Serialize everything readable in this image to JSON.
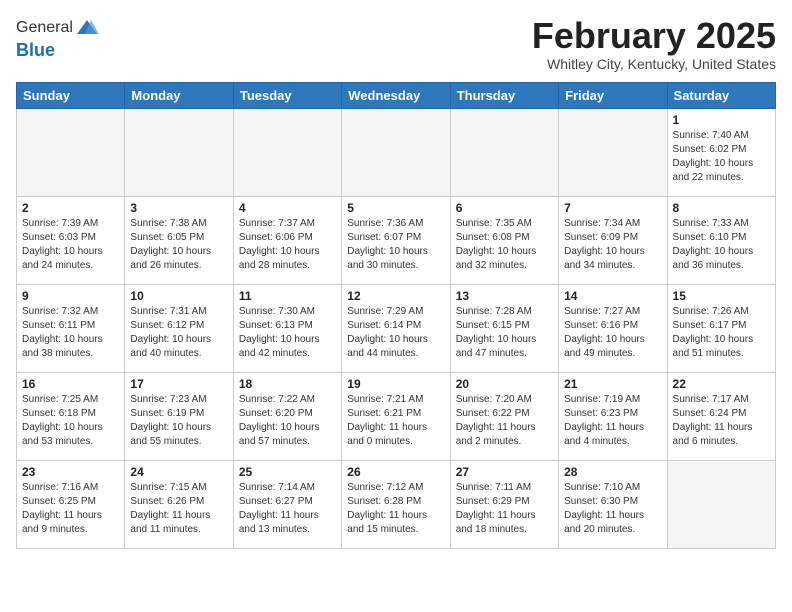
{
  "header": {
    "logo_line1": "General",
    "logo_line2": "Blue",
    "month_title": "February 2025",
    "location": "Whitley City, Kentucky, United States"
  },
  "weekdays": [
    "Sunday",
    "Monday",
    "Tuesday",
    "Wednesday",
    "Thursday",
    "Friday",
    "Saturday"
  ],
  "weeks": [
    [
      {
        "day": "",
        "info": ""
      },
      {
        "day": "",
        "info": ""
      },
      {
        "day": "",
        "info": ""
      },
      {
        "day": "",
        "info": ""
      },
      {
        "day": "",
        "info": ""
      },
      {
        "day": "",
        "info": ""
      },
      {
        "day": "1",
        "info": "Sunrise: 7:40 AM\nSunset: 6:02 PM\nDaylight: 10 hours and 22 minutes."
      }
    ],
    [
      {
        "day": "2",
        "info": "Sunrise: 7:39 AM\nSunset: 6:03 PM\nDaylight: 10 hours and 24 minutes."
      },
      {
        "day": "3",
        "info": "Sunrise: 7:38 AM\nSunset: 6:05 PM\nDaylight: 10 hours and 26 minutes."
      },
      {
        "day": "4",
        "info": "Sunrise: 7:37 AM\nSunset: 6:06 PM\nDaylight: 10 hours and 28 minutes."
      },
      {
        "day": "5",
        "info": "Sunrise: 7:36 AM\nSunset: 6:07 PM\nDaylight: 10 hours and 30 minutes."
      },
      {
        "day": "6",
        "info": "Sunrise: 7:35 AM\nSunset: 6:08 PM\nDaylight: 10 hours and 32 minutes."
      },
      {
        "day": "7",
        "info": "Sunrise: 7:34 AM\nSunset: 6:09 PM\nDaylight: 10 hours and 34 minutes."
      },
      {
        "day": "8",
        "info": "Sunrise: 7:33 AM\nSunset: 6:10 PM\nDaylight: 10 hours and 36 minutes."
      }
    ],
    [
      {
        "day": "9",
        "info": "Sunrise: 7:32 AM\nSunset: 6:11 PM\nDaylight: 10 hours and 38 minutes."
      },
      {
        "day": "10",
        "info": "Sunrise: 7:31 AM\nSunset: 6:12 PM\nDaylight: 10 hours and 40 minutes."
      },
      {
        "day": "11",
        "info": "Sunrise: 7:30 AM\nSunset: 6:13 PM\nDaylight: 10 hours and 42 minutes."
      },
      {
        "day": "12",
        "info": "Sunrise: 7:29 AM\nSunset: 6:14 PM\nDaylight: 10 hours and 44 minutes."
      },
      {
        "day": "13",
        "info": "Sunrise: 7:28 AM\nSunset: 6:15 PM\nDaylight: 10 hours and 47 minutes."
      },
      {
        "day": "14",
        "info": "Sunrise: 7:27 AM\nSunset: 6:16 PM\nDaylight: 10 hours and 49 minutes."
      },
      {
        "day": "15",
        "info": "Sunrise: 7:26 AM\nSunset: 6:17 PM\nDaylight: 10 hours and 51 minutes."
      }
    ],
    [
      {
        "day": "16",
        "info": "Sunrise: 7:25 AM\nSunset: 6:18 PM\nDaylight: 10 hours and 53 minutes."
      },
      {
        "day": "17",
        "info": "Sunrise: 7:23 AM\nSunset: 6:19 PM\nDaylight: 10 hours and 55 minutes."
      },
      {
        "day": "18",
        "info": "Sunrise: 7:22 AM\nSunset: 6:20 PM\nDaylight: 10 hours and 57 minutes."
      },
      {
        "day": "19",
        "info": "Sunrise: 7:21 AM\nSunset: 6:21 PM\nDaylight: 11 hours and 0 minutes."
      },
      {
        "day": "20",
        "info": "Sunrise: 7:20 AM\nSunset: 6:22 PM\nDaylight: 11 hours and 2 minutes."
      },
      {
        "day": "21",
        "info": "Sunrise: 7:19 AM\nSunset: 6:23 PM\nDaylight: 11 hours and 4 minutes."
      },
      {
        "day": "22",
        "info": "Sunrise: 7:17 AM\nSunset: 6:24 PM\nDaylight: 11 hours and 6 minutes."
      }
    ],
    [
      {
        "day": "23",
        "info": "Sunrise: 7:16 AM\nSunset: 6:25 PM\nDaylight: 11 hours and 9 minutes."
      },
      {
        "day": "24",
        "info": "Sunrise: 7:15 AM\nSunset: 6:26 PM\nDaylight: 11 hours and 11 minutes."
      },
      {
        "day": "25",
        "info": "Sunrise: 7:14 AM\nSunset: 6:27 PM\nDaylight: 11 hours and 13 minutes."
      },
      {
        "day": "26",
        "info": "Sunrise: 7:12 AM\nSunset: 6:28 PM\nDaylight: 11 hours and 15 minutes."
      },
      {
        "day": "27",
        "info": "Sunrise: 7:11 AM\nSunset: 6:29 PM\nDaylight: 11 hours and 18 minutes."
      },
      {
        "day": "28",
        "info": "Sunrise: 7:10 AM\nSunset: 6:30 PM\nDaylight: 11 hours and 20 minutes."
      },
      {
        "day": "",
        "info": ""
      }
    ]
  ]
}
